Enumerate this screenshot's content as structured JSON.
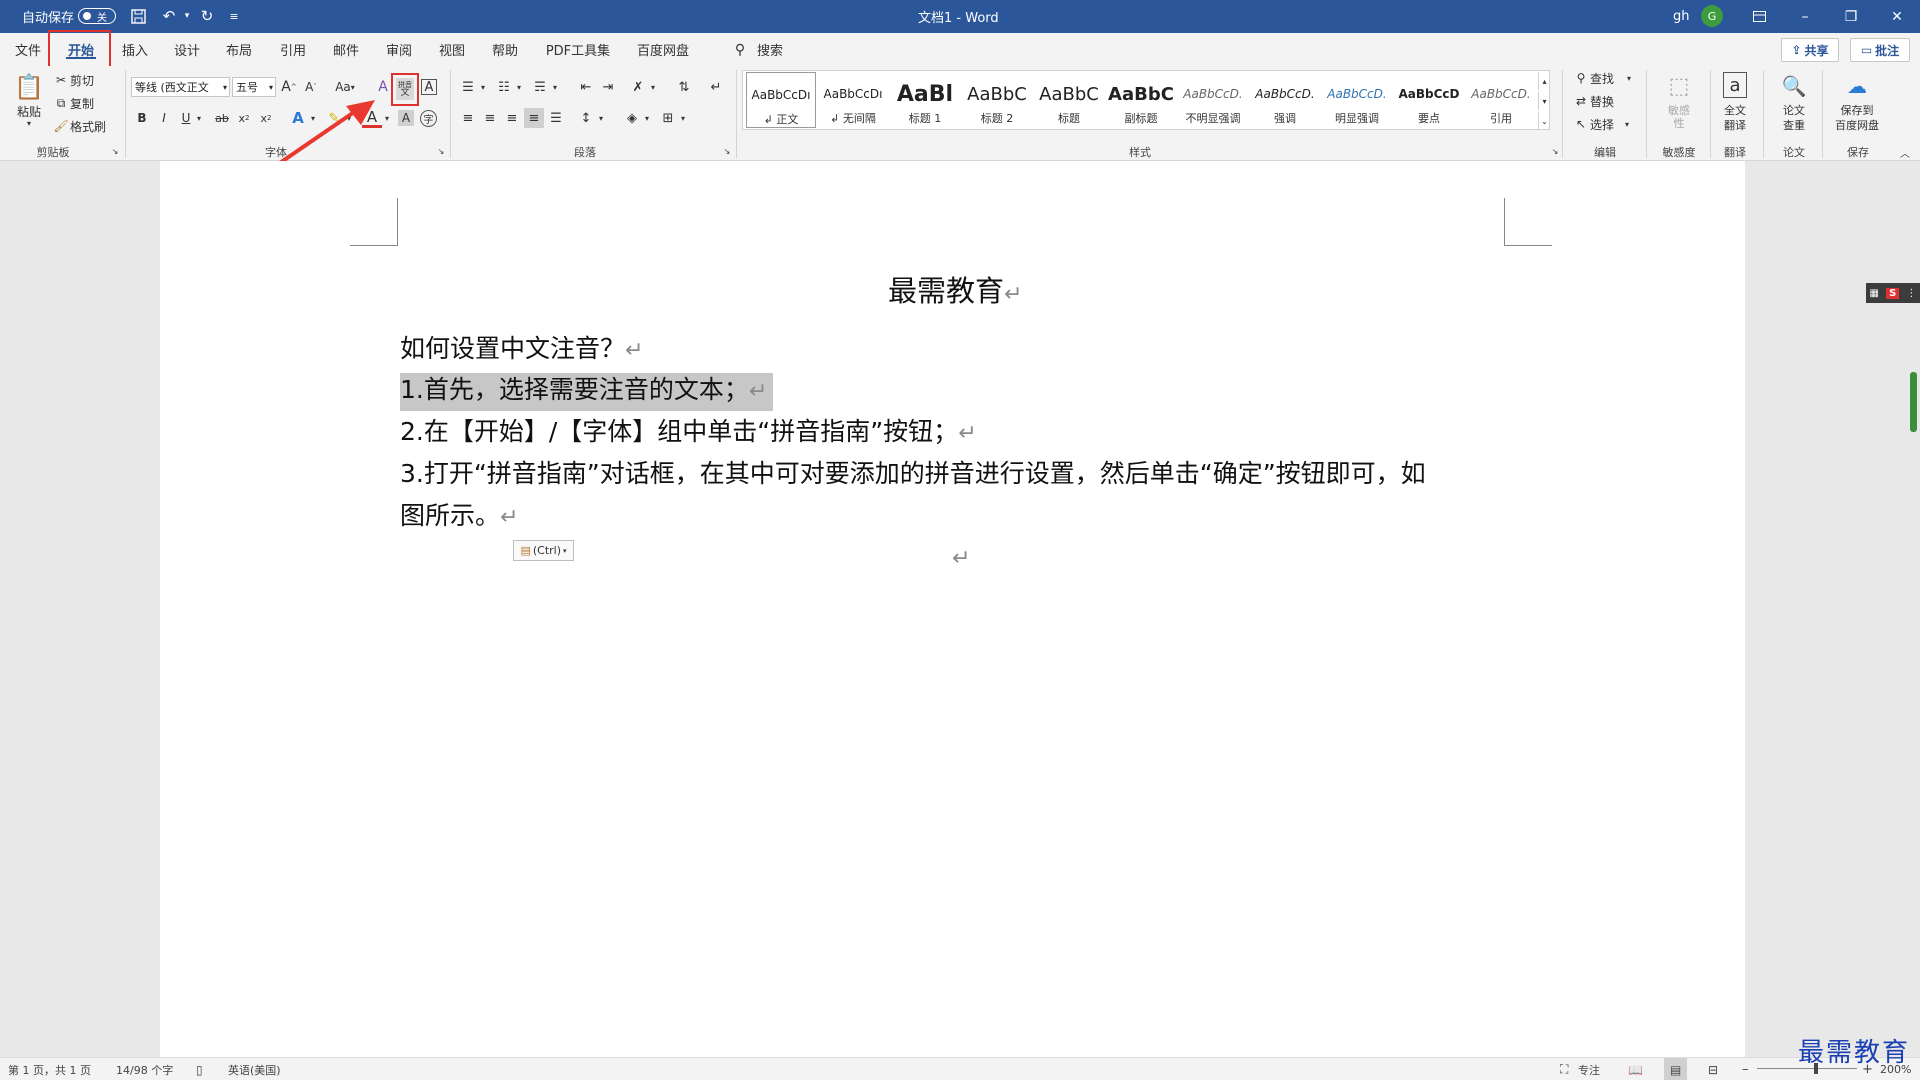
{
  "titlebar": {
    "autosave_label": "自动保存",
    "autosave_state": "关",
    "doc_title": "文档1  -  Word",
    "user_initials": "gh",
    "avatar_letter": "G"
  },
  "tabs": [
    "文件",
    "开始",
    "插入",
    "设计",
    "布局",
    "引用",
    "邮件",
    "审阅",
    "视图",
    "帮助",
    "PDF工具集",
    "百度网盘"
  ],
  "search_label": "搜索",
  "share_label": "共享",
  "comment_label": "批注",
  "clipboard": {
    "paste": "粘贴",
    "cut": "剪切",
    "copy": "复制",
    "format_painter": "格式刷",
    "group": "剪贴板"
  },
  "font": {
    "family": "等线 (西文正文",
    "size": "五号",
    "case": "Aa",
    "phonetic_guide": "拼音",
    "group": "字体"
  },
  "paragraph": {
    "group": "段落"
  },
  "styles": {
    "group": "样式",
    "items": [
      {
        "sample": "AaBbCcDı",
        "name": "↲ 正文"
      },
      {
        "sample": "AaBbCcDı",
        "name": "↲ 无间隔"
      },
      {
        "sample": "AaBl",
        "name": "标题 1"
      },
      {
        "sample": "AaBbC",
        "name": "标题 2"
      },
      {
        "sample": "AaBbC",
        "name": "标题"
      },
      {
        "sample": "AaBbC",
        "name": "副标题"
      },
      {
        "sample": "AaBbCcD.",
        "name": "不明显强调"
      },
      {
        "sample": "AaBbCcD.",
        "name": "强调"
      },
      {
        "sample": "AaBbCcD.",
        "name": "明显强调"
      },
      {
        "sample": "AaBbCcD",
        "name": "要点"
      },
      {
        "sample": "AaBbCcD.",
        "name": "引用"
      }
    ]
  },
  "editing": {
    "find": "查找",
    "replace": "替换",
    "select": "选择",
    "group": "编辑"
  },
  "sensitivity": {
    "label": "敏感\n性",
    "group": "敏感度"
  },
  "translate": {
    "label1": "全文",
    "label2": "翻译",
    "group": "翻译"
  },
  "paper": {
    "label1": "论文",
    "label2": "查重",
    "group": "论文"
  },
  "baidu_save": {
    "label1": "保存到",
    "label2": "百度网盘",
    "group": "保存"
  },
  "document": {
    "title": "最需教育",
    "lines": [
      "如何设置中文注音？",
      "1.首先，选择需要注音的文本；",
      "2.在【开始】/【字体】组中单击“拼音指南”按钮；",
      "3.打开“拼音指南”对话框，在其中可对要添加的拼音进行设置，然后单击“确定”按钮即可，如",
      "图所示。"
    ],
    "paste_options": "(Ctrl)"
  },
  "status": {
    "page": "第 1 页，共 1 页",
    "words": "14/98 个字",
    "language": "英语(美国)",
    "focus": "专注",
    "zoom": "200%"
  },
  "watermark": "最需教育",
  "colors": {
    "accent": "#2b579a",
    "highlight_box": "#e03131",
    "font_color": "#e03131"
  }
}
